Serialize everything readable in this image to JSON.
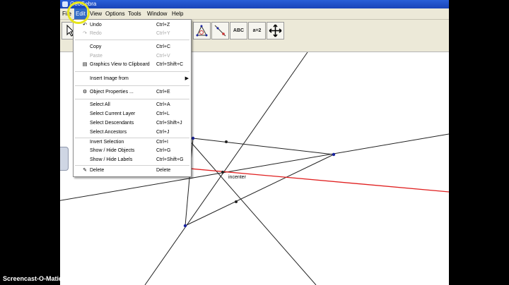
{
  "window": {
    "title": "GeoGebra"
  },
  "menubar": [
    "File",
    "Edit",
    "View",
    "Options",
    "Tools",
    "Window",
    "Help"
  ],
  "toolbar": {
    "tools": [
      {
        "name": "move-tool",
        "label": ""
      },
      {
        "name": "triangle-tool",
        "label": ""
      },
      {
        "name": "line-tool",
        "label": ""
      },
      {
        "name": "text-tool",
        "label": "ABC"
      },
      {
        "name": "slider-tool",
        "label": "a=2"
      },
      {
        "name": "move-view-tool",
        "label": ""
      }
    ]
  },
  "edit_menu": {
    "items": [
      {
        "label": "Undo",
        "shortcut": "Ctrl+Z",
        "enabled": true,
        "icon": "undo-icon"
      },
      {
        "label": "Redo",
        "shortcut": "Ctrl+Y",
        "enabled": false,
        "icon": "redo-icon"
      },
      {
        "label": "Copy",
        "shortcut": "Ctrl+C",
        "enabled": true
      },
      {
        "label": "Paste",
        "shortcut": "Ctrl+V",
        "enabled": false
      },
      {
        "label": "Graphics View to Clipboard",
        "shortcut": "Ctrl+Shift+C",
        "enabled": true,
        "icon": "clipboard-icon"
      },
      {
        "label": "Insert Image from",
        "shortcut": "",
        "enabled": true,
        "submenu": true
      },
      {
        "label": "Object Properties ...",
        "shortcut": "Ctrl+E",
        "enabled": true,
        "icon": "properties-icon"
      },
      {
        "label": "Select All",
        "shortcut": "Ctrl+A",
        "enabled": true
      },
      {
        "label": "Select Current Layer",
        "shortcut": "Ctrl+L",
        "enabled": true
      },
      {
        "label": "Select Descendants",
        "shortcut": "Ctrl+Shift+J",
        "enabled": true
      },
      {
        "label": "Select Ancestors",
        "shortcut": "Ctrl+J",
        "enabled": true
      },
      {
        "label": "Invert Selection",
        "shortcut": "Ctrl+I",
        "enabled": true
      },
      {
        "label": "Show / Hide Objects",
        "shortcut": "Ctrl+G",
        "enabled": true
      },
      {
        "label": "Show / Hide Labels",
        "shortcut": "Ctrl+Shift+G",
        "enabled": true
      },
      {
        "label": "Delete",
        "shortcut": "Delete",
        "enabled": true,
        "icon": "eraser-icon"
      }
    ]
  },
  "canvas": {
    "incenter_label": "incenter"
  },
  "colors": {
    "menu_highlight": "#316ac5",
    "line_red": "#e02020",
    "point_blue": "#1a24a0",
    "titlebar_blue": "#2459d0"
  },
  "watermark": "Screencast-O-Matic.com"
}
